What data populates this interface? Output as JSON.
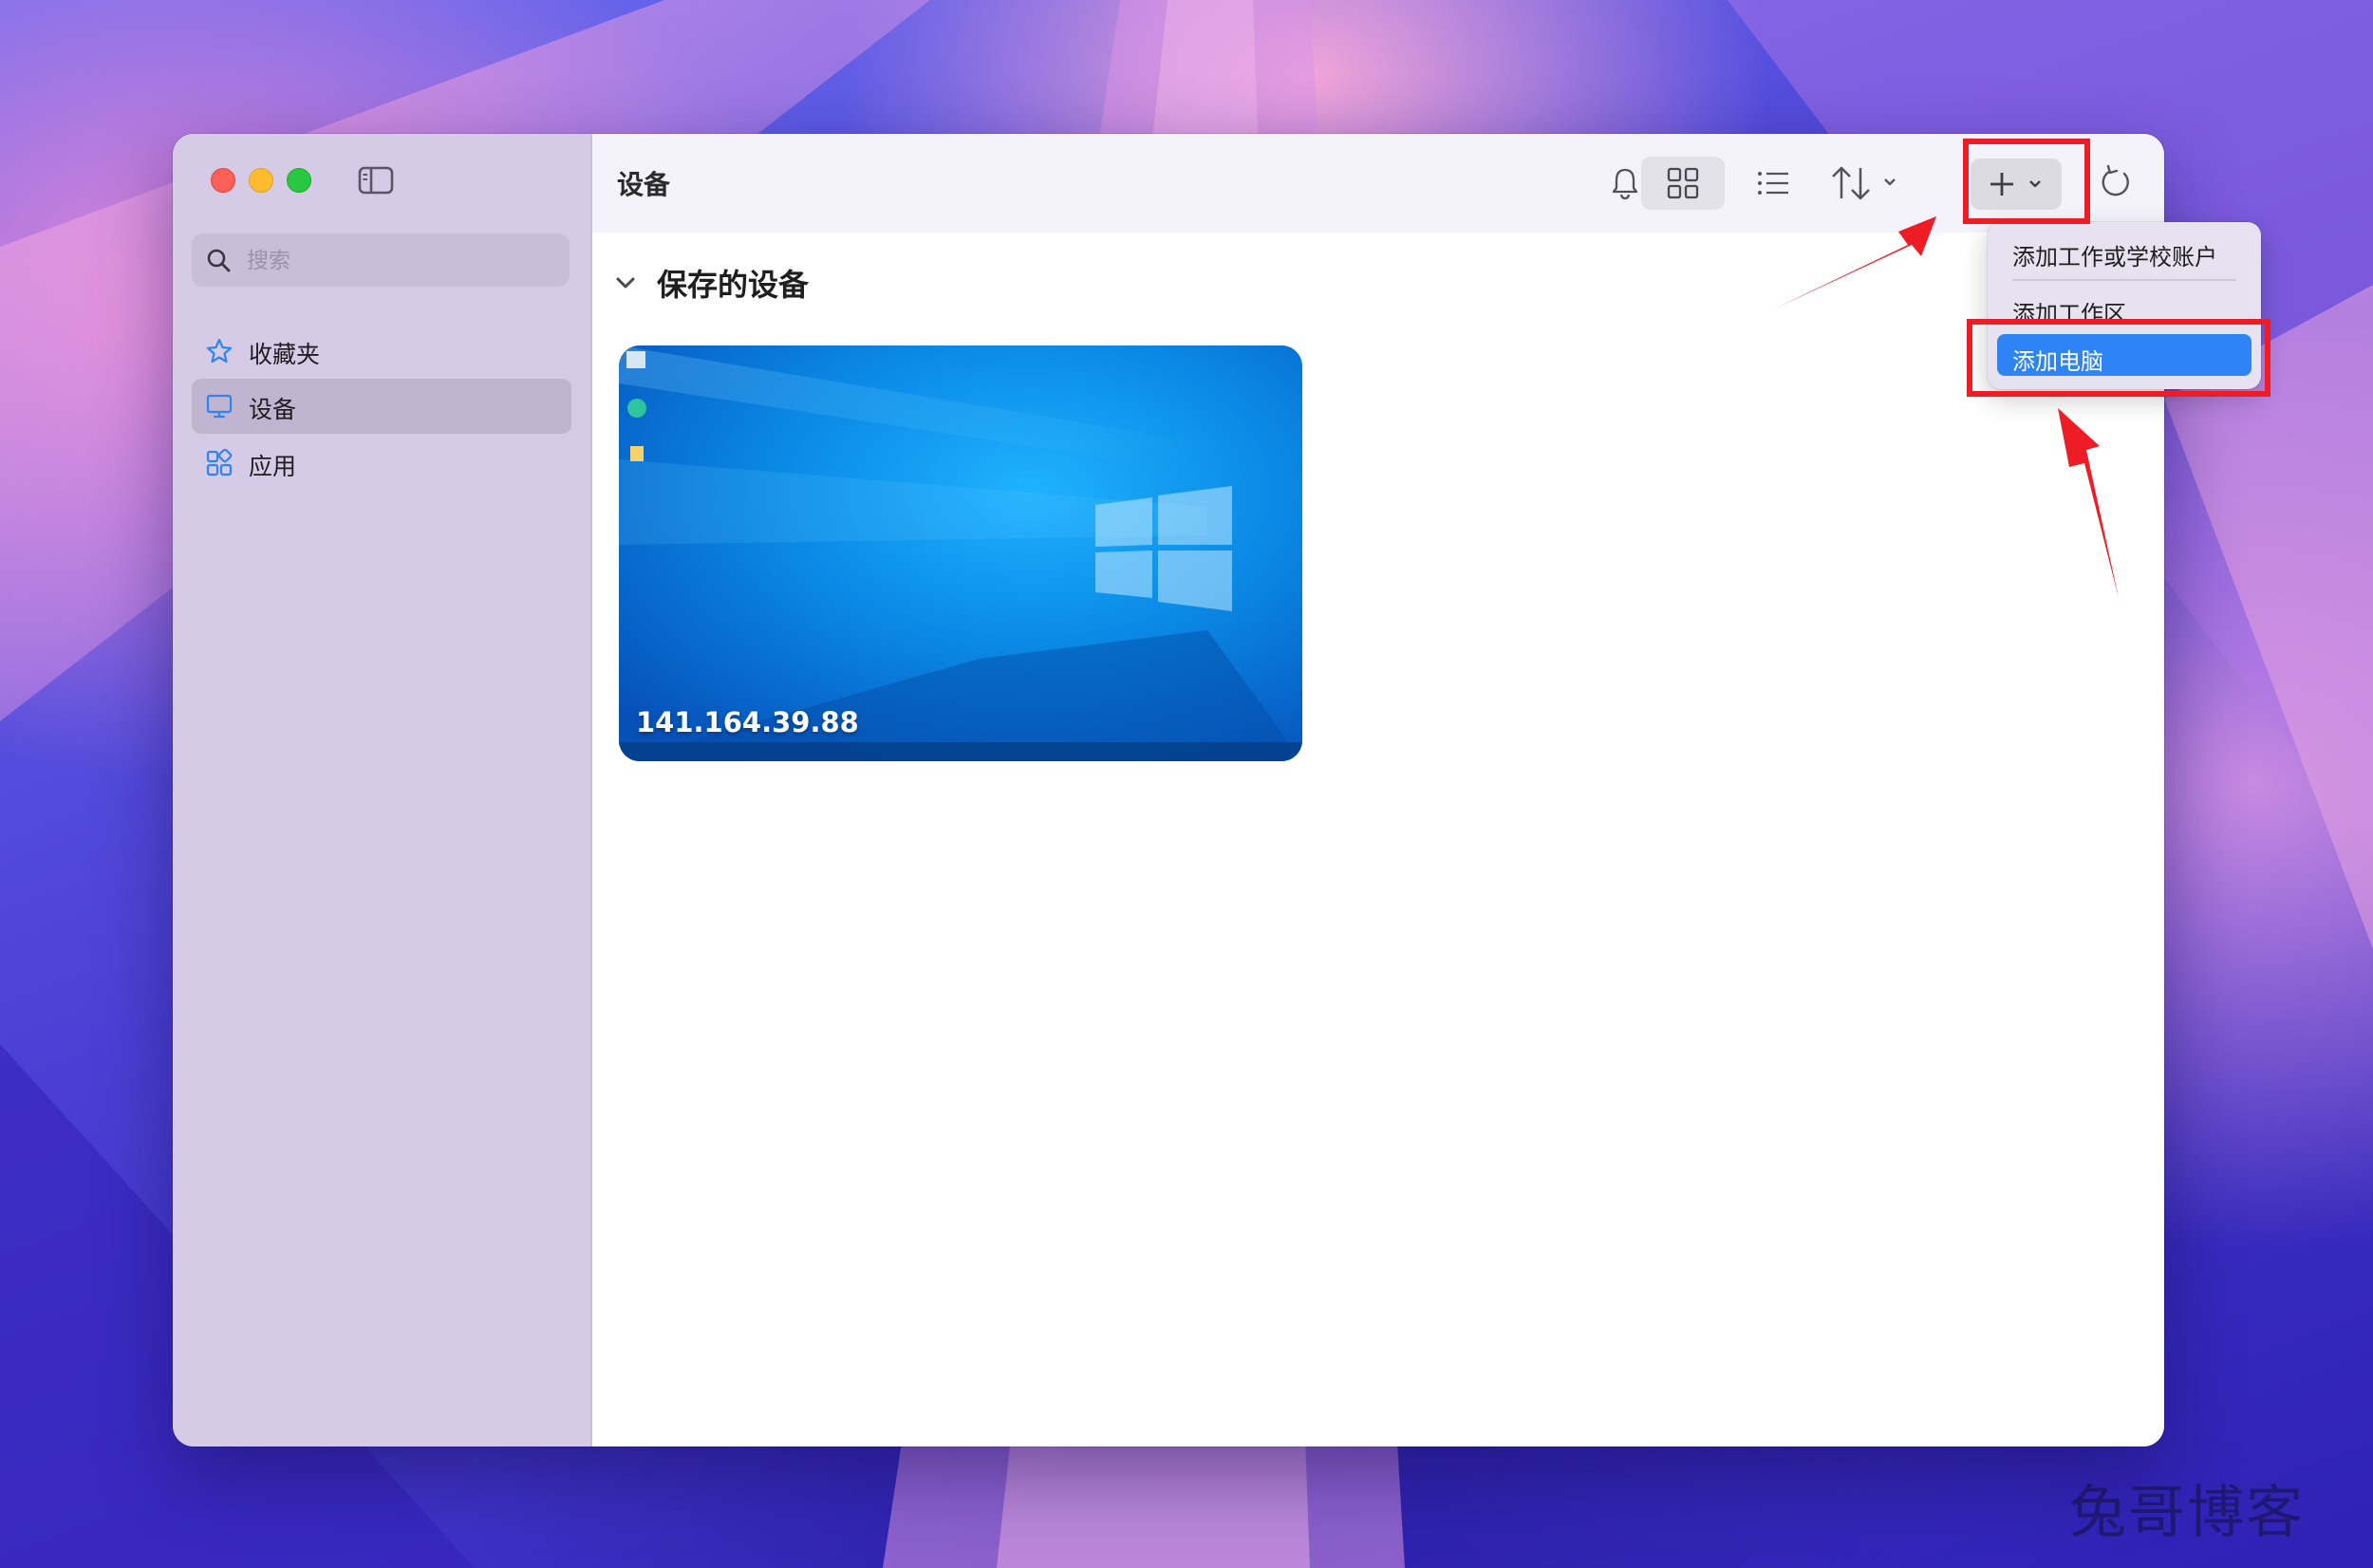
{
  "window": {
    "title": "设备"
  },
  "sidebar": {
    "search_placeholder": "搜索",
    "items": [
      {
        "label": "收藏夹",
        "icon": "star-icon"
      },
      {
        "label": "设备",
        "icon": "monitor-icon",
        "active": true
      },
      {
        "label": "应用",
        "icon": "apps-icon"
      }
    ]
  },
  "toolbar": {
    "icons": [
      "bell-icon",
      "grid-view-icon",
      "list-view-icon",
      "sort-icon",
      "plus-icon",
      "refresh-icon"
    ]
  },
  "content": {
    "section_title": "保存的设备",
    "device": {
      "name": "141.164.39.88"
    }
  },
  "add_menu": {
    "items": [
      {
        "label": "添加工作或学校账户"
      },
      {
        "label": "添加工作区"
      },
      {
        "label": "添加电脑",
        "selected": true
      }
    ]
  },
  "annotations": {
    "highlight_color": "#ee1c25"
  },
  "watermark": "兔哥博客",
  "colors": {
    "accent": "#2f84f5",
    "sidebar": "#d6cbe6",
    "close": "#fe5f57",
    "minimize": "#febc2e",
    "maximize": "#28c840"
  }
}
